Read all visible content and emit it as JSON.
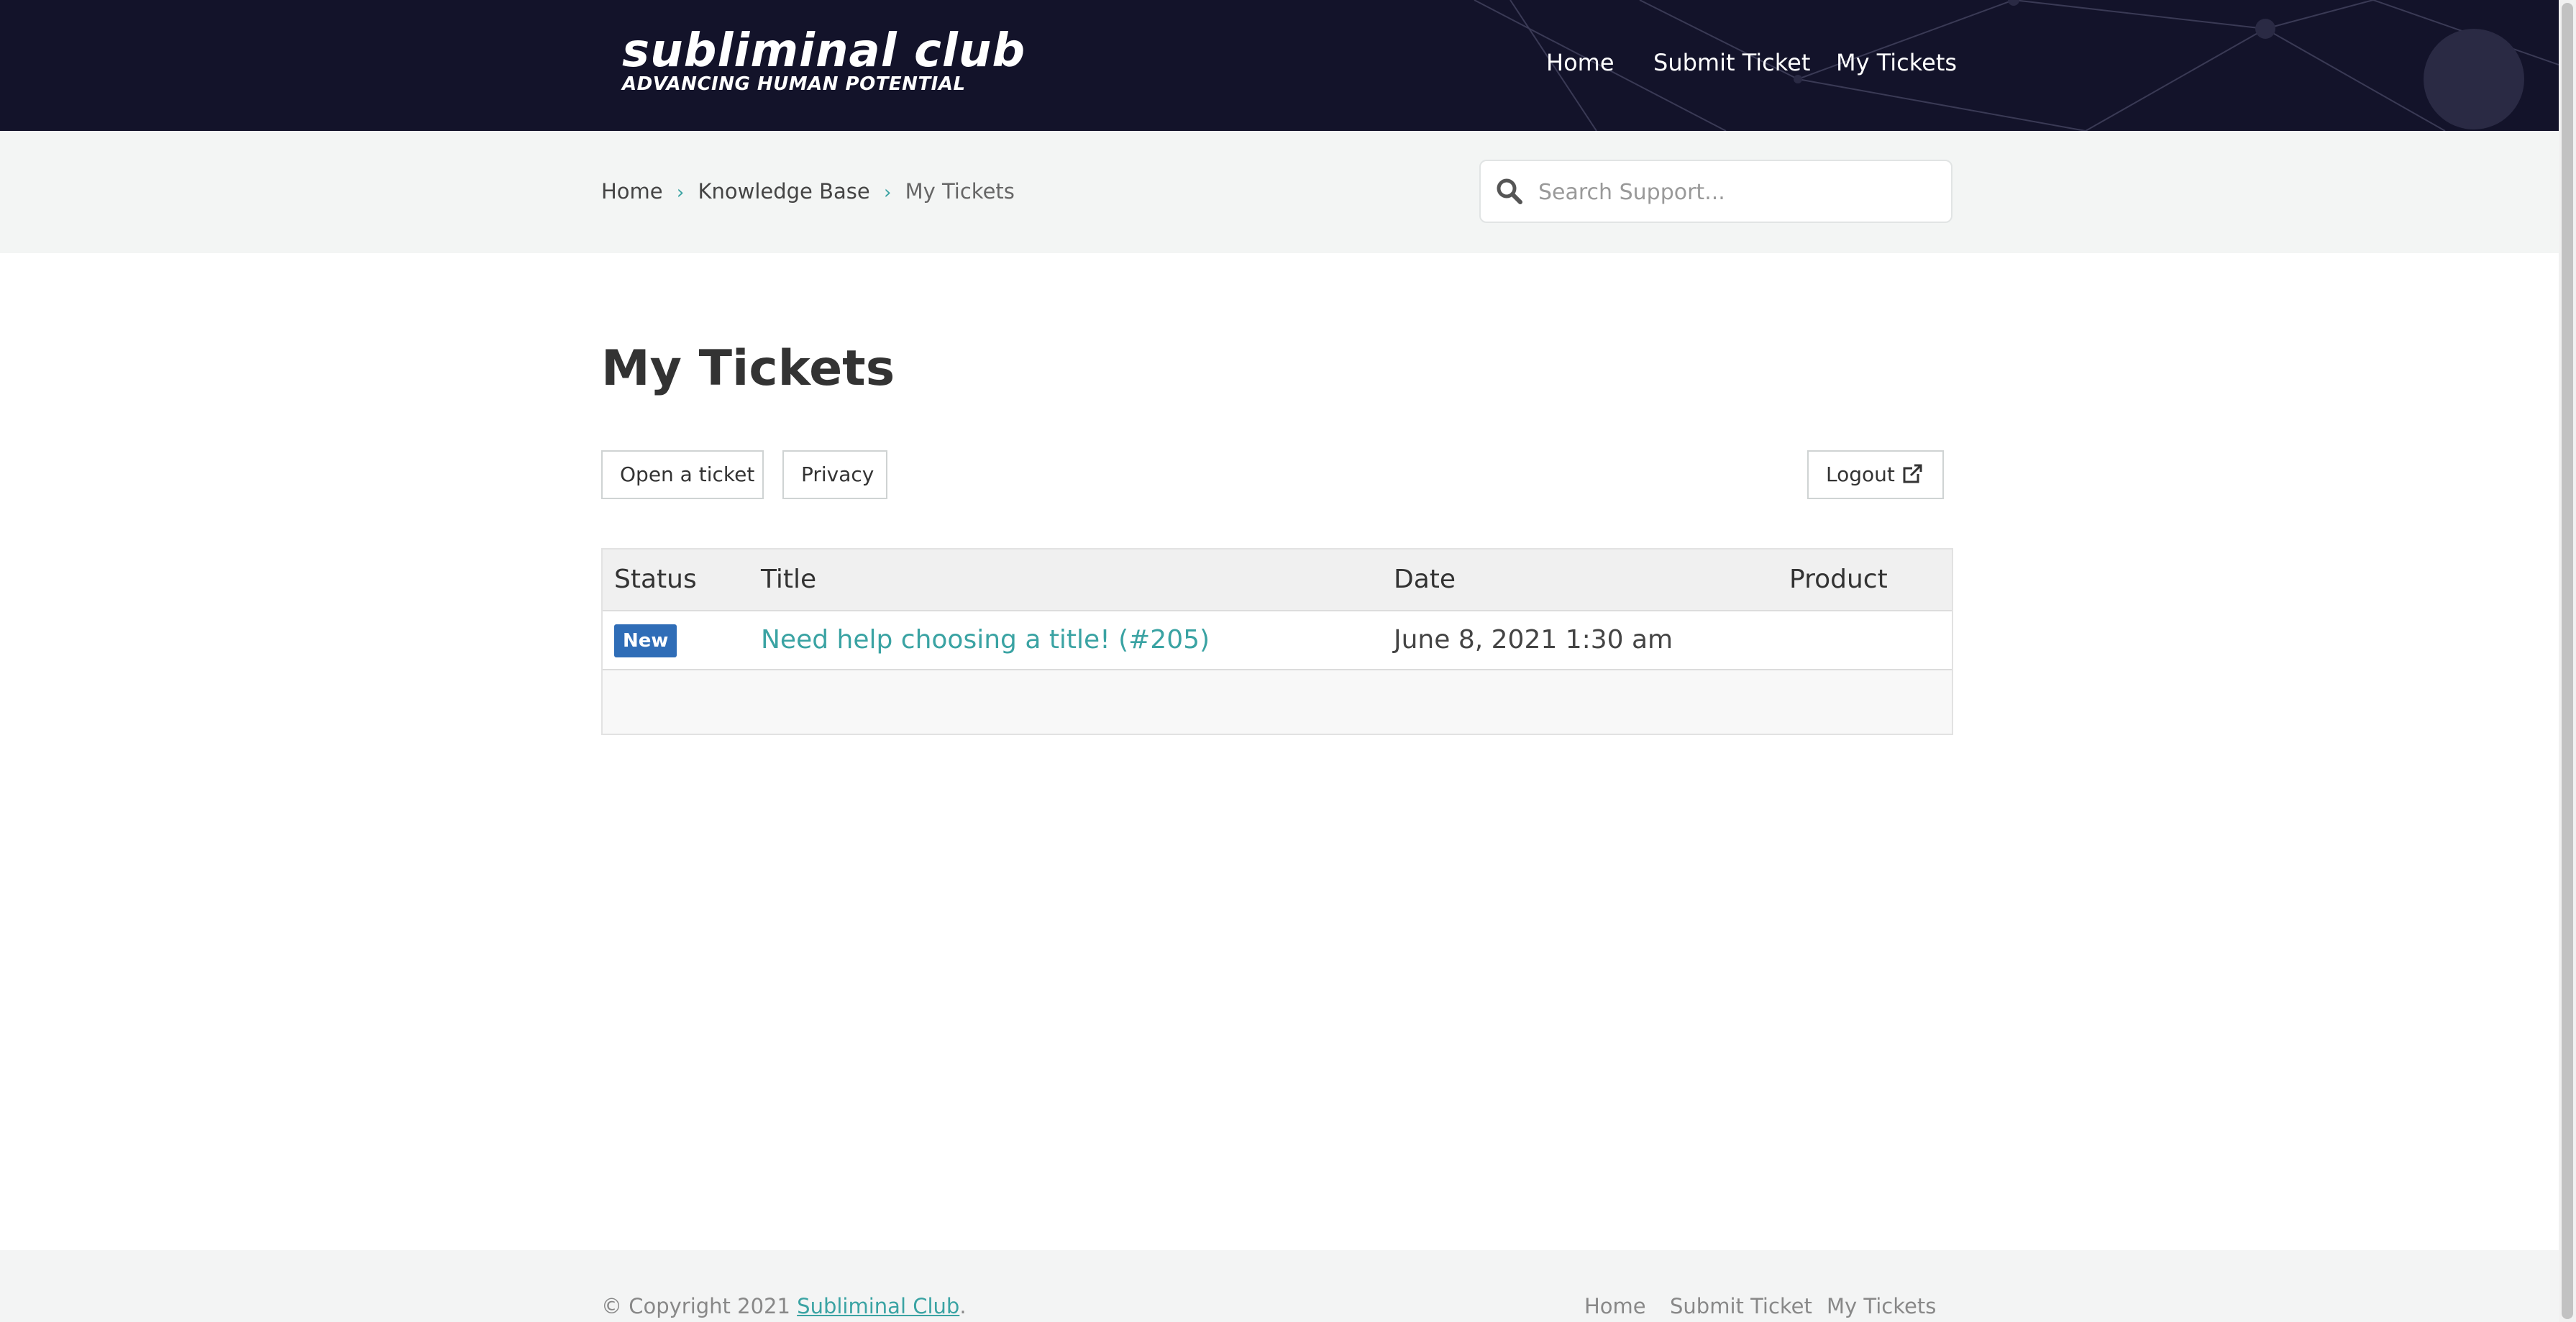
{
  "header": {
    "logo_main": "subliminal club",
    "logo_sub": "ADVANCING HUMAN POTENTIAL",
    "nav": [
      "Home",
      "Submit Ticket",
      "My Tickets"
    ]
  },
  "breadcrumb": {
    "items": [
      "Home",
      "Knowledge Base"
    ],
    "current": "My Tickets",
    "separator": "›"
  },
  "search": {
    "placeholder": "Search Support...",
    "value": ""
  },
  "main": {
    "title": "My Tickets",
    "buttons": {
      "open_ticket": "Open a ticket",
      "privacy": "Privacy",
      "logout": "Logout"
    }
  },
  "table": {
    "columns": [
      "Status",
      "Title",
      "Date",
      "Product"
    ],
    "rows": [
      {
        "status": "New",
        "title": "Need help choosing a title! (#205)",
        "date": "June 8, 2021 1:30 am",
        "product": ""
      }
    ]
  },
  "footer": {
    "copyright_prefix": "© Copyright 2021",
    "copyright_link": "Subliminal Club",
    "copyright_suffix": ".",
    "nav": [
      "Home",
      "Submit Ticket",
      "My Tickets"
    ]
  },
  "colors": {
    "header_bg": "#13132a",
    "accent": "#3aa3a3",
    "badge_new": "#2f6db7",
    "subbar_bg": "#f3f5f4"
  },
  "icons": {
    "search": "search-icon",
    "logout": "external-link-icon",
    "breadcrumb_separator": "chevron-right-icon"
  }
}
